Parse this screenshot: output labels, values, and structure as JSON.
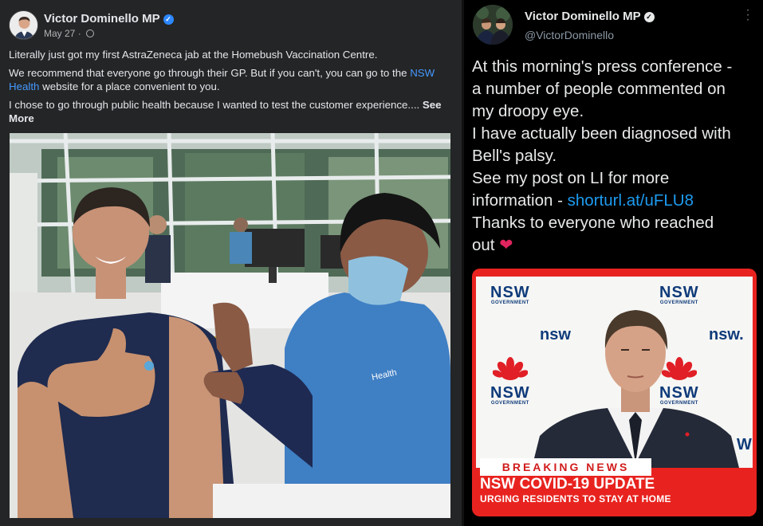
{
  "facebook": {
    "author": "Victor Dominello MP",
    "date": "May 27",
    "privacy_icon": "globe-icon",
    "paragraphs": {
      "p1": "Literally just got my first AstraZeneca jab at the Homebush Vaccination Centre.",
      "p2_before": "We recommend that everyone go through their GP. But if you can't, you can go to the ",
      "p2_link": "NSW Health",
      "p2_after": " website for a place convenient to you.",
      "p3": "I chose to go through public health because I wanted to test the customer experience.... ",
      "see_more": "See More"
    },
    "photo_text": {
      "vest_label": "Health"
    },
    "colors": {
      "background": "#242526",
      "link": "#4599ff",
      "verified": "#2d88ff"
    }
  },
  "twitter": {
    "author": "Victor Dominello MP",
    "handle": "@VictorDominello",
    "more_icon": "more-vertical-icon",
    "text": {
      "l1": "At this morning's press conference -",
      "l2": "a number of people commented on",
      "l3": "my droopy eye.",
      "l4": "I have actually been diagnosed with",
      "l5": "Bell's palsy.",
      "l6": "See my post on LI for more",
      "l7_before": "information - ",
      "l7_link": "shorturl.at/uFLU8",
      "l8": "Thanks to everyone who reached",
      "l9": "out ",
      "heart": "❤"
    },
    "media": {
      "logo_word": "NSW",
      "logo_sub": "GOVERNMENT",
      "wordmark_1": "nsw",
      "wordmark_2": "nsw.",
      "side_letter": "W",
      "ticker_label": "BREAKING NEWS",
      "headline": "NSW COVID-19 UPDATE",
      "subline": "URGING RESIDENTS TO STAY AT HOME"
    },
    "colors": {
      "background": "#000000",
      "link": "#1d9bf0",
      "heart": "#e0245e",
      "ticker_red": "#e8231f"
    }
  }
}
